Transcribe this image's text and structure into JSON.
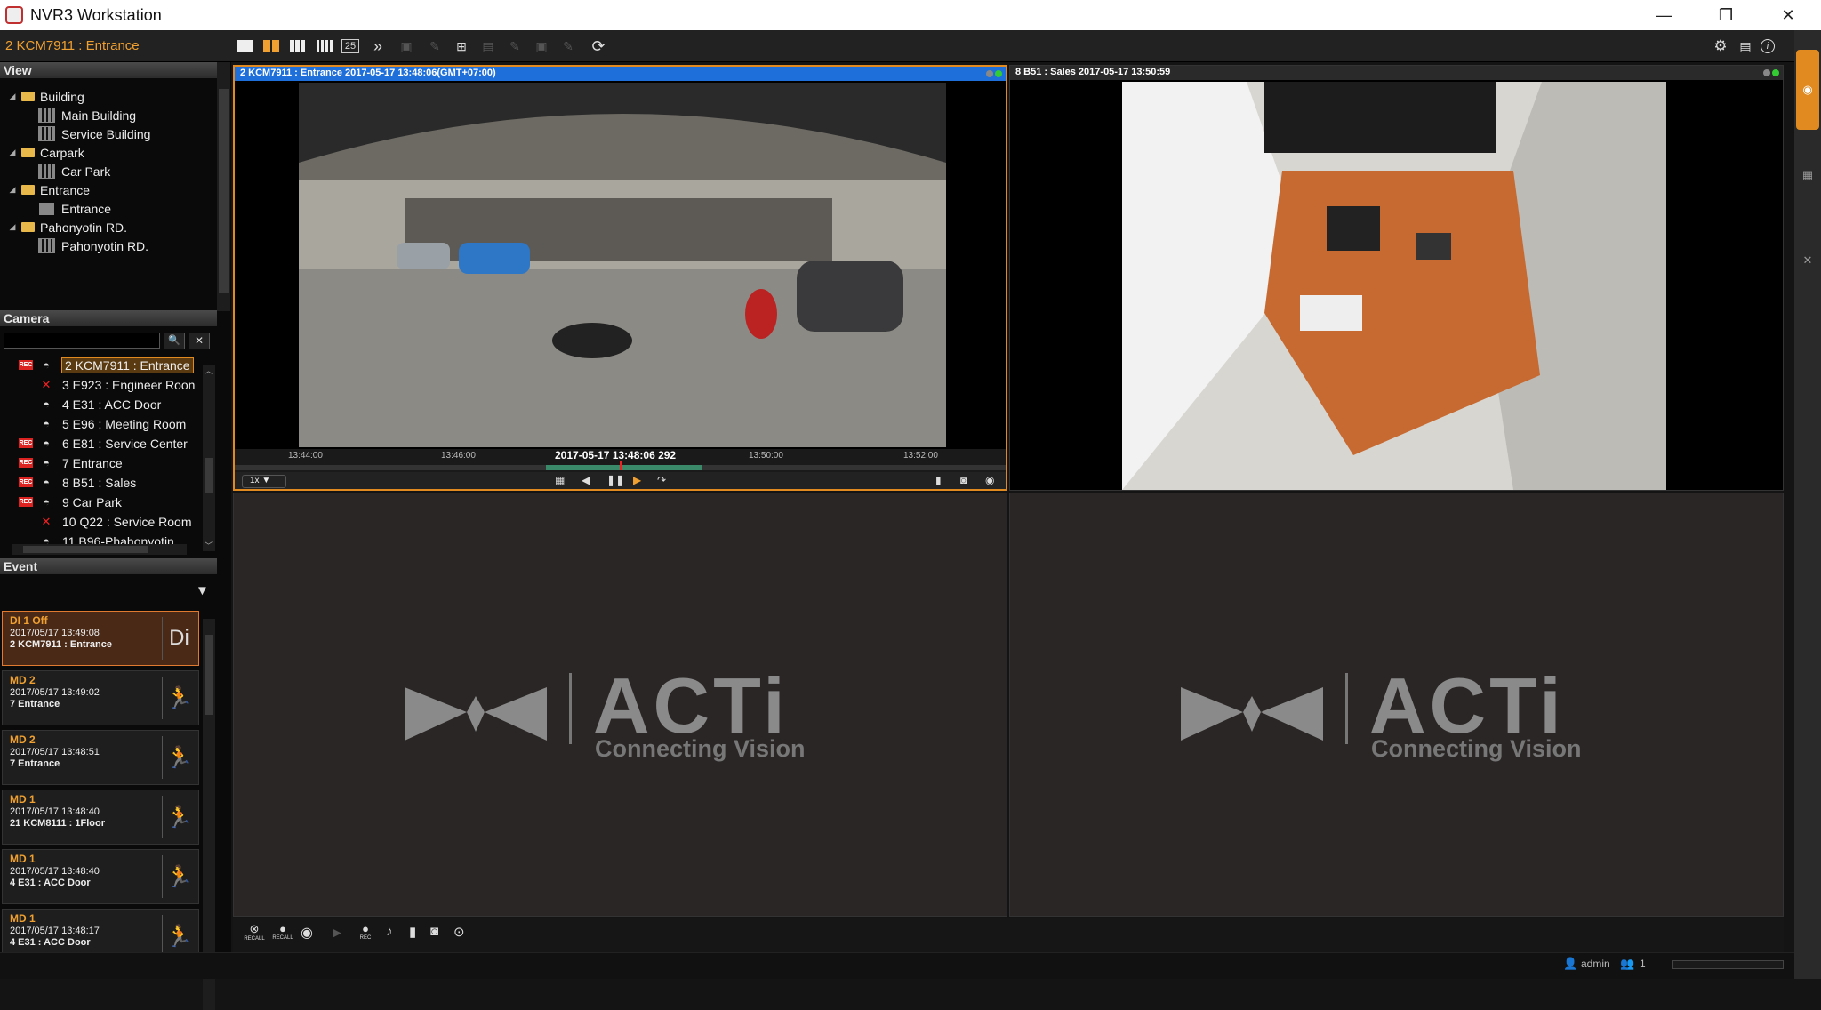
{
  "window": {
    "title": "NVR3 Workstation",
    "minimize": "—",
    "restore": "❐",
    "close": "✕"
  },
  "toolbar": {
    "current_camera": "2 KCM7911 : Entrance",
    "layout25": "25",
    "more": "»",
    "refresh": "⟳",
    "settings": "⚙",
    "doc": "▤",
    "info": "i"
  },
  "view": {
    "header": "View",
    "items": [
      {
        "label": "Building",
        "level": 0,
        "icon": "folder-icon"
      },
      {
        "label": "Main Building",
        "level": 1,
        "icon": "grid-layout-icon"
      },
      {
        "label": "Service Building",
        "level": 1,
        "icon": "grid-layout-icon"
      },
      {
        "label": "Carpark",
        "level": 0,
        "icon": "folder-icon"
      },
      {
        "label": "Car Park",
        "level": 1,
        "icon": "grid-layout-icon"
      },
      {
        "label": "Entrance",
        "level": 0,
        "icon": "folder-icon"
      },
      {
        "label": "Entrance",
        "level": 1,
        "icon": "single-layout-icon"
      },
      {
        "label": "Pahonyotin RD.",
        "level": 0,
        "icon": "folder-icon"
      },
      {
        "label": "Pahonyotin RD.",
        "level": 1,
        "icon": "grid-layout-icon"
      }
    ]
  },
  "camera": {
    "header": "Camera",
    "search_placeholder": "",
    "search_icon": "🔍",
    "clear_icon": "✕",
    "rec_badge": "REC",
    "items": [
      {
        "label": "2 KCM7911 : Entrance",
        "rec": true,
        "status": "ok",
        "selected": true
      },
      {
        "label": "3 E923 : Engineer Roon",
        "rec": false,
        "status": "offline"
      },
      {
        "label": "4 E31 : ACC Door",
        "rec": false,
        "status": "ok"
      },
      {
        "label": "5 E96 : Meeting Room",
        "rec": false,
        "status": "ok"
      },
      {
        "label": "6 E81 : Service Center",
        "rec": true,
        "status": "ok"
      },
      {
        "label": "7 Entrance",
        "rec": true,
        "status": "ok"
      },
      {
        "label": "8 B51 : Sales",
        "rec": true,
        "status": "ok"
      },
      {
        "label": "9 Car Park",
        "rec": true,
        "status": "ok"
      },
      {
        "label": "10 Q22 : Service Room",
        "rec": false,
        "status": "offline"
      },
      {
        "label": "11 B96-Phahonyotin",
        "rec": false,
        "status": "ok"
      }
    ]
  },
  "event": {
    "header": "Event",
    "filter_icon": "▼",
    "items": [
      {
        "type": "DI 1 Off",
        "time": "2017/05/17 13:49:08",
        "camera": "2 KCM7911 : Entrance",
        "icon": "Di",
        "active": true
      },
      {
        "type": "MD 2",
        "time": "2017/05/17 13:49:02",
        "camera": "7 Entrance",
        "icon": "🏃"
      },
      {
        "type": "MD 2",
        "time": "2017/05/17 13:48:51",
        "camera": "7 Entrance",
        "icon": "🏃"
      },
      {
        "type": "MD 1",
        "time": "2017/05/17 13:48:40",
        "camera": "21 KCM8111 : 1Floor",
        "icon": "🏃"
      },
      {
        "type": "MD 1",
        "time": "2017/05/17 13:48:40",
        "camera": "4 E31 : ACC Door",
        "icon": "🏃"
      },
      {
        "type": "MD 1",
        "time": "2017/05/17 13:48:17",
        "camera": "4 E31 : ACC Door",
        "icon": "🏃"
      }
    ]
  },
  "panels": {
    "p1": {
      "title": "2 KCM7911 : Entrance   2017-05-17 13:48:06(GMT+07:00)",
      "ticks": [
        "13:44:00",
        "13:46:00",
        "13:50:00",
        "13:52:00"
      ],
      "current_time": "2017-05-17 13:48:06 292",
      "speed": "1x",
      "play_progress": 0.45
    },
    "p2": {
      "title": "8 B51 : Sales   2017-05-17 13:50:59"
    },
    "logo": {
      "word": "ACTi",
      "tagline": "Connecting Vision"
    }
  },
  "bottombar": {
    "recall1": "RECALL",
    "recall2": "RECALL",
    "rec": "REC"
  },
  "status": {
    "user": "admin",
    "users_count": "1"
  },
  "colors": {
    "accent": "#e08a20",
    "panel_header": "#1e6fd9",
    "rec": "#dd2222"
  }
}
